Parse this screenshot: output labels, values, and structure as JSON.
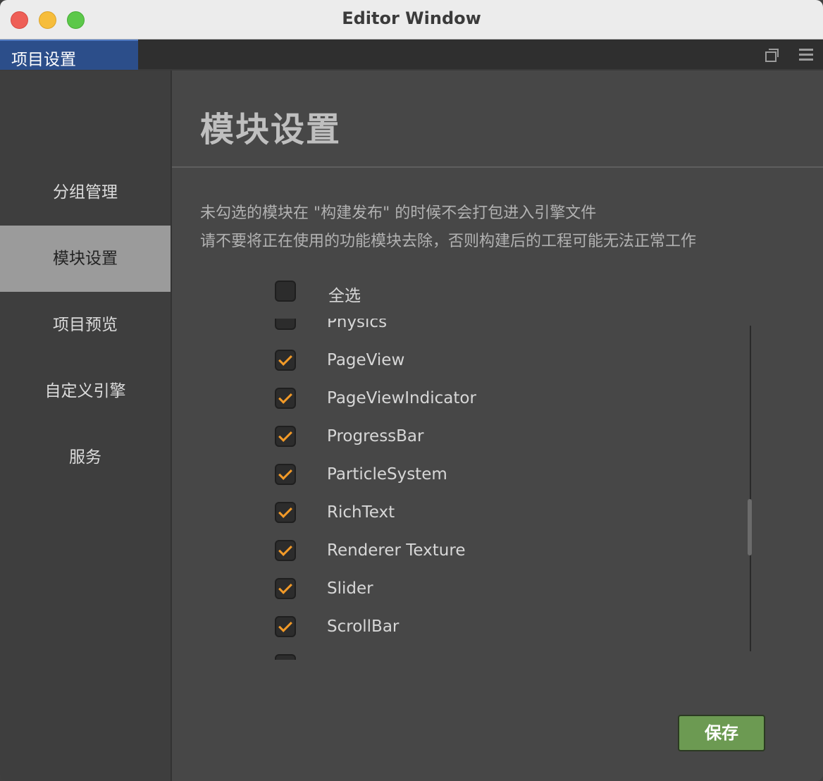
{
  "window": {
    "title": "Editor Window"
  },
  "tab": {
    "label": "项目设置"
  },
  "tab_icons": [
    "popout-icon",
    "menu-icon"
  ],
  "sidebar": {
    "items": [
      {
        "label": "分组管理",
        "active": false
      },
      {
        "label": "模块设置",
        "active": true
      },
      {
        "label": "项目预览",
        "active": false
      },
      {
        "label": "自定义引擎",
        "active": false
      },
      {
        "label": "服务",
        "active": false
      }
    ]
  },
  "main": {
    "title": "模块设置",
    "description_line1": "未勾选的模块在 \"构建发布\" 的时候不会打包进入引擎文件",
    "description_line2": "请不要将正在使用的功能模块去除，否则构建后的工程可能无法正常工作",
    "select_all": {
      "label": "全选",
      "checked": false
    },
    "modules": [
      {
        "name": "Physics",
        "checked": false
      },
      {
        "name": "PageView",
        "checked": true
      },
      {
        "name": "PageViewIndicator",
        "checked": true
      },
      {
        "name": "ProgressBar",
        "checked": true
      },
      {
        "name": "ParticleSystem",
        "checked": true
      },
      {
        "name": "RichText",
        "checked": true
      },
      {
        "name": "Renderer Texture",
        "checked": true
      },
      {
        "name": "Slider",
        "checked": true
      },
      {
        "name": "ScrollBar",
        "checked": true
      },
      {
        "name": "",
        "checked": false
      }
    ],
    "save_label": "保存"
  },
  "colors": {
    "accent_tab": "#2c4e8a",
    "check": "#f29a28",
    "save_button": "#6c9a52",
    "sidebar_active": "#9b9b9b"
  }
}
